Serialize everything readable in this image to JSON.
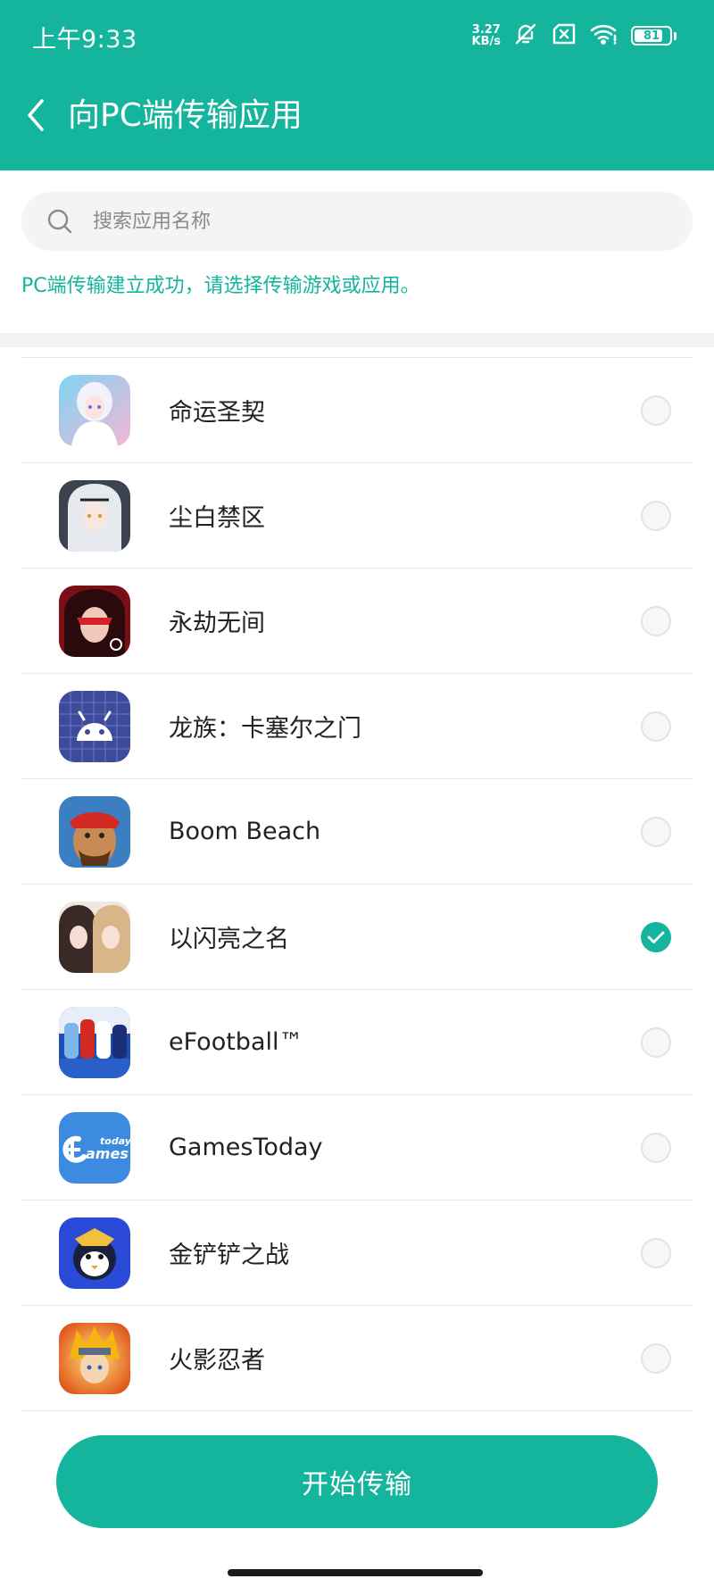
{
  "status_bar": {
    "time": "上午9:33",
    "net_speed_value": "3.27",
    "net_speed_unit": "KB/s",
    "battery_level": "81",
    "battery_fraction": 0.81,
    "icons": [
      "notifications-muted-icon",
      "sim-off-icon",
      "wifi-icon",
      "battery-icon"
    ]
  },
  "header": {
    "back_icon": "chevron-left-icon",
    "title": "向PC端传输应用"
  },
  "search": {
    "icon": "search-icon",
    "placeholder": "搜索应用名称",
    "value": ""
  },
  "notice": "PC端传输建立成功，请选择传输游戏或应用。",
  "apps": [
    {
      "name": "命运圣契",
      "checked": false
    },
    {
      "name": "尘白禁区",
      "checked": false
    },
    {
      "name": "永劫无间",
      "checked": false
    },
    {
      "name": "龙族：卡塞尔之门",
      "checked": false
    },
    {
      "name": "Boom Beach",
      "checked": false
    },
    {
      "name": "以闪亮之名",
      "checked": true
    },
    {
      "name": "eFootball™",
      "checked": false
    },
    {
      "name": "GamesToday",
      "checked": false
    },
    {
      "name": "金铲铲之战",
      "checked": false
    },
    {
      "name": "火影忍者",
      "checked": false
    }
  ],
  "gamestoday_icon_text": {
    "small": "today",
    "big": "ames"
  },
  "start_button_label": "开始传输",
  "colors": {
    "accent": "#14b59c",
    "divider": "#e8e8e8",
    "search_bg": "#f4f4f4"
  }
}
